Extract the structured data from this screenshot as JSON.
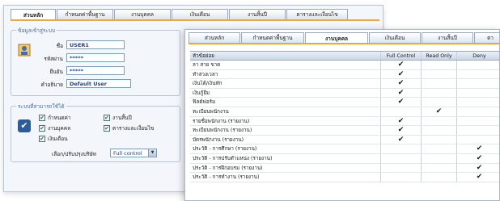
{
  "back_window": {
    "tabs": [
      "ส่วนหลัก",
      "กำหนดค่าพื้นฐาน",
      "งานบุคคล",
      "เงินเดือน",
      "งานสิ้นปี",
      "ตารางและเงื่อนไข"
    ],
    "login_group": {
      "title": "ข้อมูลเข้าสู่ระบบ",
      "name_label": "ชื่อ",
      "name_value": "USER1",
      "password_label": "รหัสผ่าน",
      "password_value": "*****",
      "confirm_label": "ยืนยัน",
      "confirm_value": "*****",
      "description_label": "คำอธิบาย",
      "description_value": "Default User"
    },
    "access_group": {
      "title": "ระบบที่สามารถใช้ได้",
      "options": [
        "กำหนดค่า",
        "งานสิ้นปี",
        "งานบุคคล",
        "ตารางและเงื่อนไข",
        "เงินเดือน"
      ],
      "company_label": "เลือก/ปรับปรุงบริษัท",
      "company_value": "Full control"
    }
  },
  "front_window": {
    "tabs": [
      "ส่วนหลัก",
      "กำหนดค่าพื้นฐาน",
      "งานบุคคล",
      "เงินเดือน",
      "งานสิ้นปี",
      "ตา"
    ],
    "grid": {
      "headers": [
        "หัวข้อย่อย",
        "Full Control",
        "Read Only",
        "Deny"
      ],
      "rows": [
        {
          "name": "ลา สาย ขาด",
          "perm": "full"
        },
        {
          "name": "ทำล่วงเวลา",
          "perm": "full"
        },
        {
          "name": "เงินได้/เงินหัก",
          "perm": "full"
        },
        {
          "name": "เงินกู้ยืม",
          "perm": "full"
        },
        {
          "name": "ฟิลด์ฟอร์ม",
          "perm": "full"
        },
        {
          "name": "ทะเบียนพนักงาน",
          "perm": "read"
        },
        {
          "name": "รายชื่อพนักงาน (รายงาน)",
          "perm": "full"
        },
        {
          "name": "ทะเบียนพนักงาน (รายงาน)",
          "perm": "full"
        },
        {
          "name": "บัตรพนักงาน (รายงาน)",
          "perm": "full"
        },
        {
          "name": "ประวัติ - การศึกษา (รายงาน)",
          "perm": "deny"
        },
        {
          "name": "ประวัติ - การปรับตำแหน่ง (รายงาน)",
          "perm": "deny"
        },
        {
          "name": "ประวัติ - การฝึกอบรม (รายงาน)",
          "perm": "deny"
        },
        {
          "name": "ประวัติ - การทำงาน (รายงาน)",
          "perm": "deny"
        }
      ],
      "check_glyph": "✔"
    }
  }
}
